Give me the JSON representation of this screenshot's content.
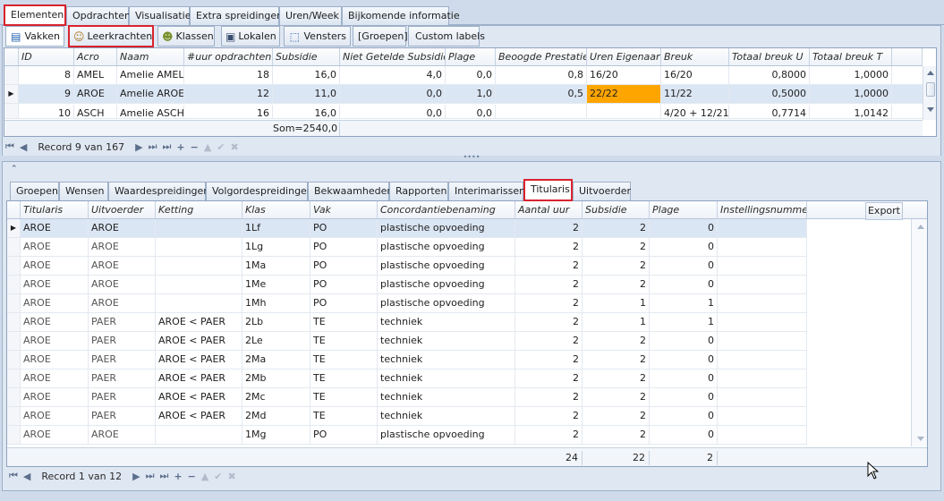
{
  "main_tabs": [
    "Elementen",
    "Opdrachten",
    "Visualisatie",
    "Extra spreidingen",
    "Uren/Week",
    "Bijkomende informatie"
  ],
  "sub_tabs": [
    {
      "label": "Vakken",
      "icon": "book-icon"
    },
    {
      "label": "Leerkrachten",
      "icon": "person-icon"
    },
    {
      "label": "Klassen",
      "icon": "group-icon"
    },
    {
      "label": "Lokalen",
      "icon": "room-icon"
    },
    {
      "label": "Vensters",
      "icon": "window-icon"
    },
    {
      "label": "[Groepen]",
      "icon": ""
    },
    {
      "label": "Custom labels",
      "icon": ""
    }
  ],
  "top_grid": {
    "columns": [
      "ID",
      "Acro",
      "Naam",
      "#uur opdrachten",
      "Subsidie",
      "Niet Getelde Subsidie",
      "Plage",
      "Beoogde Prestatie",
      "Uren Eigenaar",
      "Breuk",
      "Totaal breuk U",
      "Totaal breuk T"
    ],
    "rows": [
      {
        "id": "8",
        "acro": "AMEL",
        "naam": "Amelie AMEL",
        "uur": "18",
        "subsidie": "16,0",
        "ngs": "4,0",
        "plage": "0,0",
        "beoogd": "0,8",
        "uren": "16/20",
        "breuk": "16/20",
        "tbu": "0,8000",
        "tbt": "1,0000"
      },
      {
        "id": "9",
        "acro": "AROE",
        "naam": "Amelie AROE",
        "uur": "12",
        "subsidie": "11,0",
        "ngs": "0,0",
        "plage": "1,0",
        "beoogd": "0,5",
        "uren": "22/22",
        "breuk": "11/22",
        "tbu": "0,5000",
        "tbt": "1,0000"
      },
      {
        "id": "10",
        "acro": "ASCH",
        "naam": "Amelie ASCH",
        "uur": "16",
        "subsidie": "16,0",
        "ngs": "0,0",
        "plage": "0,0",
        "beoogd": "",
        "uren": "",
        "breuk": "4/20 + 12/21",
        "tbu": "0,7714",
        "tbt": "1,0142"
      }
    ],
    "footer_sum": "Som=2540,0",
    "record_text": "Record 9 van 167"
  },
  "detail_tabs": [
    "Groepen",
    "Wensen",
    "Waardespreidingen",
    "Volgordespreidingen",
    "Bekwaamheden",
    "Rapporten",
    "Interimarissen",
    "Titularis",
    "Uitvoerder"
  ],
  "export_label": "Export",
  "bottom_grid": {
    "columns": [
      "Titularis",
      "Uitvoerder",
      "Ketting",
      "Klas",
      "Vak",
      "Concordantiebenaming",
      "Aantal uur",
      "Subsidie",
      "Plage",
      "Instellingsnummer"
    ],
    "rows": [
      {
        "tit": "AROE",
        "uit": "AROE",
        "ket": "",
        "klas": "1Lf",
        "vak": "PO",
        "conc": "plastische opvoeding",
        "uur": "2",
        "sub": "2",
        "plage": "0"
      },
      {
        "tit": "AROE",
        "uit": "AROE",
        "ket": "",
        "klas": "1Lg",
        "vak": "PO",
        "conc": "plastische opvoeding",
        "uur": "2",
        "sub": "2",
        "plage": "0"
      },
      {
        "tit": "AROE",
        "uit": "AROE",
        "ket": "",
        "klas": "1Ma",
        "vak": "PO",
        "conc": "plastische opvoeding",
        "uur": "2",
        "sub": "2",
        "plage": "0"
      },
      {
        "tit": "AROE",
        "uit": "AROE",
        "ket": "",
        "klas": "1Me",
        "vak": "PO",
        "conc": "plastische opvoeding",
        "uur": "2",
        "sub": "2",
        "plage": "0"
      },
      {
        "tit": "AROE",
        "uit": "AROE",
        "ket": "",
        "klas": "1Mh",
        "vak": "PO",
        "conc": "plastische opvoeding",
        "uur": "2",
        "sub": "1",
        "plage": "1"
      },
      {
        "tit": "AROE",
        "uit": "PAER",
        "ket": "AROE < PAER",
        "klas": "2Lb",
        "vak": "TE",
        "conc": "techniek",
        "uur": "2",
        "sub": "1",
        "plage": "1"
      },
      {
        "tit": "AROE",
        "uit": "PAER",
        "ket": "AROE < PAER",
        "klas": "2Le",
        "vak": "TE",
        "conc": "techniek",
        "uur": "2",
        "sub": "2",
        "plage": "0"
      },
      {
        "tit": "AROE",
        "uit": "PAER",
        "ket": "AROE < PAER",
        "klas": "2Ma",
        "vak": "TE",
        "conc": "techniek",
        "uur": "2",
        "sub": "2",
        "plage": "0"
      },
      {
        "tit": "AROE",
        "uit": "PAER",
        "ket": "AROE < PAER",
        "klas": "2Mb",
        "vak": "TE",
        "conc": "techniek",
        "uur": "2",
        "sub": "2",
        "plage": "0"
      },
      {
        "tit": "AROE",
        "uit": "PAER",
        "ket": "AROE < PAER",
        "klas": "2Mc",
        "vak": "TE",
        "conc": "techniek",
        "uur": "2",
        "sub": "2",
        "plage": "0"
      },
      {
        "tit": "AROE",
        "uit": "PAER",
        "ket": "AROE < PAER",
        "klas": "2Md",
        "vak": "TE",
        "conc": "techniek",
        "uur": "2",
        "sub": "2",
        "plage": "0"
      },
      {
        "tit": "AROE",
        "uit": "AROE",
        "ket": "",
        "klas": "1Mg",
        "vak": "PO",
        "conc": "plastische opvoeding",
        "uur": "2",
        "sub": "2",
        "plage": "0"
      }
    ],
    "totals": {
      "uur": "24",
      "sub": "22",
      "plage": "2"
    },
    "record_text": "Record 1 van 12"
  },
  "colors": {
    "highlight_orange": "#ffa500",
    "annotation_red": "#d9232e",
    "selected_row": "#dbe6f4"
  }
}
